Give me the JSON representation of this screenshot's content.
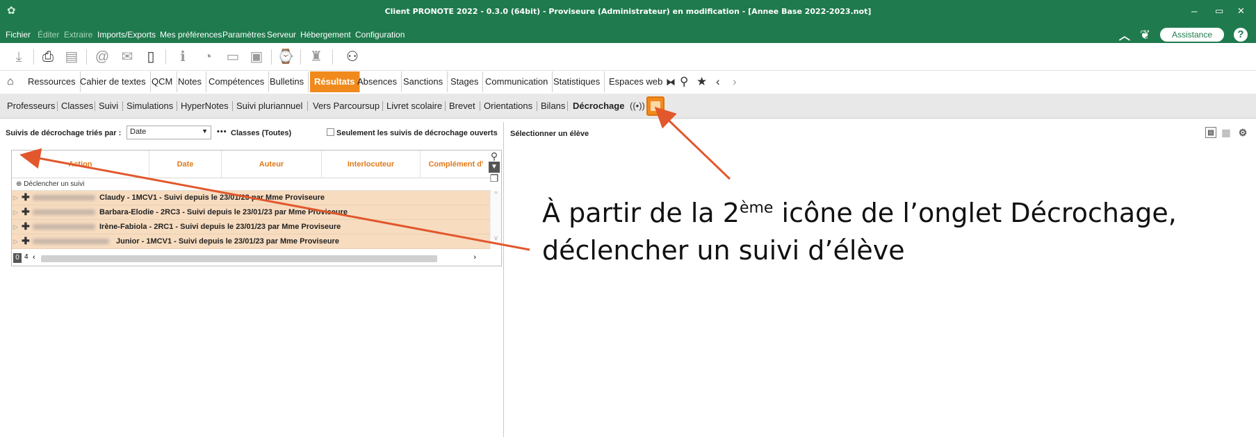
{
  "titlebar": {
    "title": "Client PRONOTE 2022 - 0.3.0 (64bit) - Proviseure (Administrateur) en modification - [Annee Base 2022-2023.not]",
    "minimize": "–",
    "restore": "▭",
    "close": "✕"
  },
  "menu": {
    "items": [
      "Fichier",
      "Éditer",
      "Extraire",
      "Imports/Exports",
      "Mes préférences",
      "Paramètres",
      "Serveur",
      "Hébergement",
      "Configuration"
    ],
    "assistance": "Assistance",
    "help": "?"
  },
  "maintabs": {
    "items": [
      "Ressources",
      "Cahier de textes",
      "QCM",
      "Notes",
      "Compétences",
      "Bulletins",
      "Résultats",
      "Absences",
      "Sanctions",
      "Stages",
      "Communication",
      "Statistiques",
      "Espaces web"
    ],
    "active": "Résultats"
  },
  "subtabs": {
    "items": [
      "Professeurs",
      "Classes",
      "Suivi",
      "Simulations",
      "HyperNotes",
      "Suivi pluriannuel",
      "Vers Parcoursup",
      "Livret scolaire",
      "Brevet",
      "Orientations",
      "Bilans",
      "Décrochage"
    ],
    "active": "Décrochage"
  },
  "filter": {
    "label": "Suivis de décrochage triés par :",
    "sort_value": "Date",
    "dots": "•••",
    "classes": "Classes (Toutes)",
    "only_open": "Seulement les suivis de décrochage ouverts"
  },
  "grid": {
    "columns": [
      "Action",
      "Date",
      "Auteur",
      "Interlocuteur",
      "Complément d'"
    ],
    "add_label": "Déclencher un suivi",
    "rows": [
      {
        "text": "Claudy - 1MCV1 - Suivi depuis le 23/01/23 par Mme Proviseure"
      },
      {
        "text": "Barbara-Elodie - 2RC3 - Suivi depuis le 23/01/23 par Mme Proviseure"
      },
      {
        "text": "Irène-Fabiola - 2RC1 - Suivi depuis le 23/01/23 par Mme Proviseure"
      },
      {
        "text": "Junior - 1MCV1 - Suivi depuis le 23/01/23 par Mme Proviseure"
      }
    ],
    "count_selected": "0",
    "count_total": "4"
  },
  "rightpanel": {
    "label": "Sélectionner un élève"
  },
  "annotation": {
    "line1_before": "À partir de la 2",
    "line1_sup": "ème",
    "line1_after": " icône de l’onglet Décrochage,",
    "line2": "déclencher un suivi d’élève"
  },
  "colors": {
    "app_green": "#1f7a4d",
    "accent_orange": "#f08a1c",
    "row_highlight": "#f7dcc0",
    "arrow": "#e2572c"
  }
}
